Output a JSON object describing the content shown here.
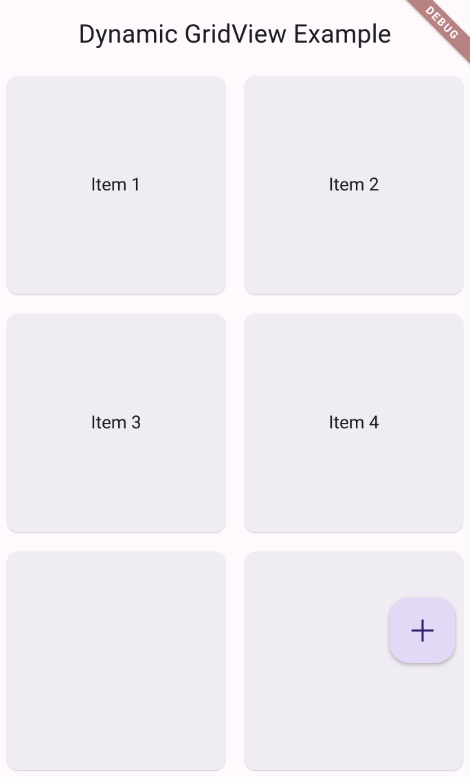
{
  "appbar": {
    "title": "Dynamic GridView Example"
  },
  "grid": {
    "items": [
      {
        "label": "Item 1"
      },
      {
        "label": "Item 2"
      },
      {
        "label": "Item 3"
      },
      {
        "label": "Item 4"
      },
      {
        "label": ""
      },
      {
        "label": ""
      }
    ]
  },
  "fab": {
    "icon": "plus-icon"
  },
  "debug": {
    "label": "DEBUG"
  },
  "colors": {
    "background": "#fdf9fd",
    "card": "#f0ecf3",
    "fab": "#e3d8f6",
    "fabIcon": "#2f1c66",
    "text": "#1c1b1f",
    "debugBanner": "#b88282"
  }
}
